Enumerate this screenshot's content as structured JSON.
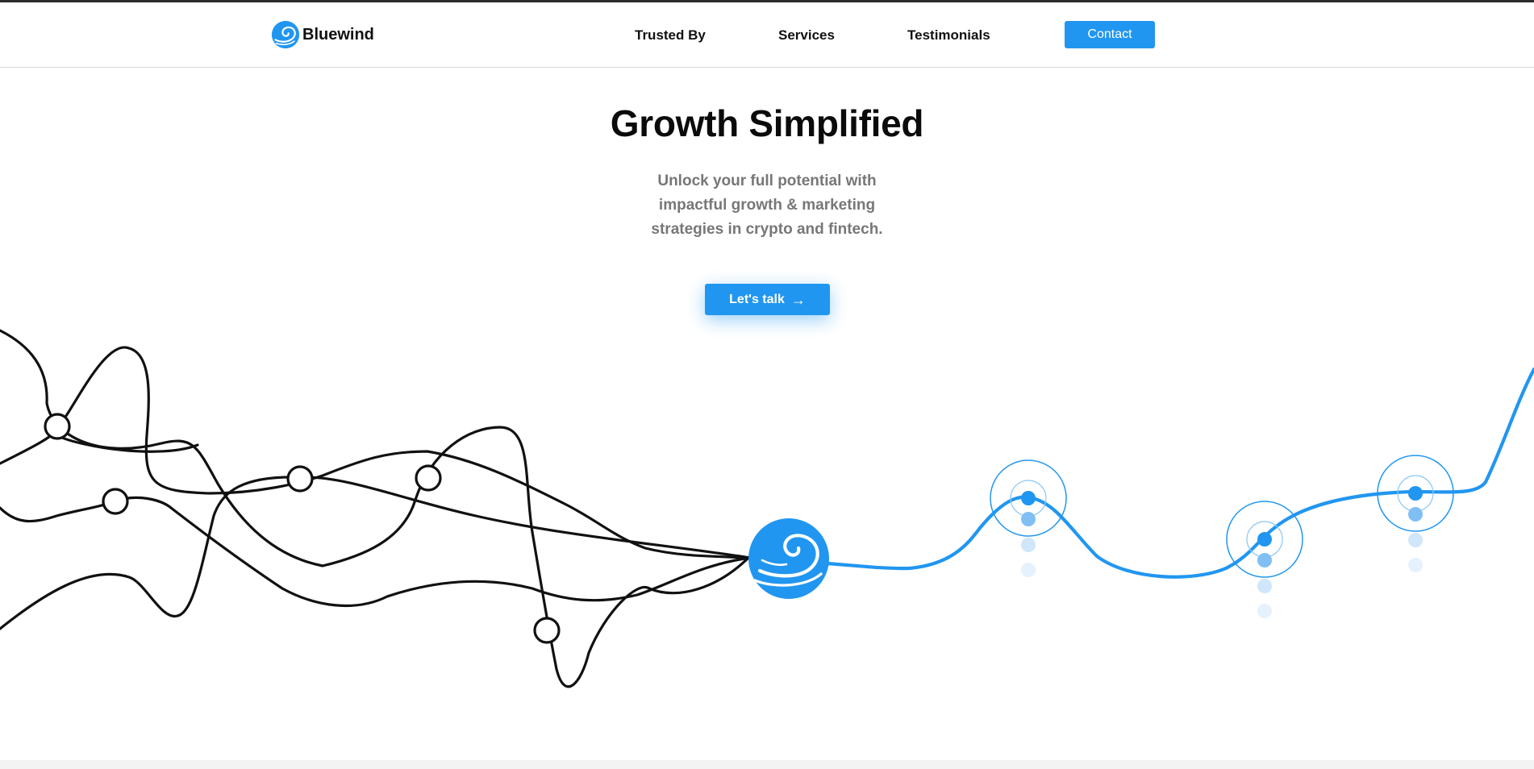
{
  "brand": {
    "name": "Bluewind",
    "logo_icon": "swirl-logo-icon"
  },
  "nav": {
    "links": [
      {
        "label": "Trusted By"
      },
      {
        "label": "Services"
      },
      {
        "label": "Testimonials"
      }
    ],
    "contact_label": "Contact"
  },
  "hero": {
    "title": "Growth Simplified",
    "subtitle": "Unlock your full potential with impactful growth & marketing strategies in crypto and fintech.",
    "cta_label": "Let's talk",
    "cta_icon": "arrow-right-icon"
  },
  "colors": {
    "accent": "#2196f0",
    "text": "#111111",
    "muted": "#777777",
    "line": "#111111"
  }
}
